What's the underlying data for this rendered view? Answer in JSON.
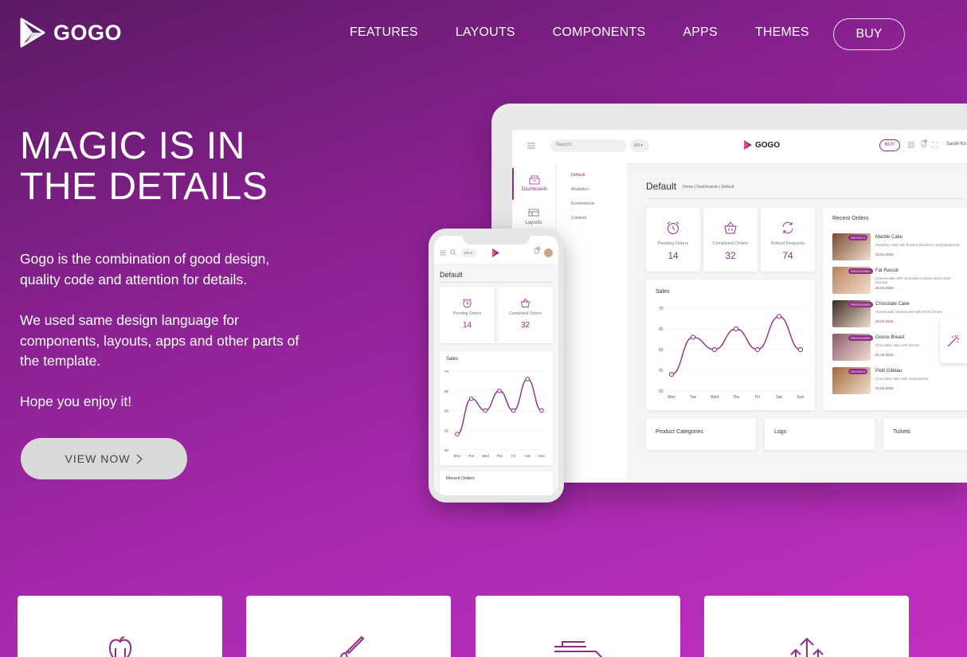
{
  "nav": {
    "logo": "GOGO",
    "links": [
      "FEATURES",
      "LAYOUTS",
      "COMPONENTS",
      "APPS",
      "THEMES"
    ],
    "buy": "BUY"
  },
  "hero": {
    "title_line1": "MAGIC IS IN",
    "title_line2": "THE DETAILS",
    "p1": "Gogo is the combination of good design, quality code and attention for details.",
    "p2": "We used same design language for components, layouts, apps and other parts of the template.",
    "p3": "Hope you enjoy it!",
    "button": "VIEW NOW"
  },
  "laptop": {
    "search": "Search",
    "lang": "EN ▾",
    "logo": "GOGO",
    "buy": "BUY",
    "user": "Sarah Ko",
    "side_dashboards": "Dashboards",
    "side_layouts": "Layouts",
    "submenu": [
      "Default",
      "Analytics",
      "Ecommerce",
      "Content"
    ],
    "page_title": "Default",
    "breadcrumb": "Home  |  Dashboards  |  Default",
    "stats": [
      {
        "label": "Pending Orders",
        "value": "14"
      },
      {
        "label": "Completed Orders",
        "value": "32"
      },
      {
        "label": "Refund Requests",
        "value": "74"
      }
    ],
    "sales_title": "Sales",
    "recent_orders_title": "Recent Orders",
    "orders": [
      {
        "name": "Marble Cake",
        "badge": "ON HOLD",
        "desc": "Wedding cake with flowers Macarons and blueberries",
        "date": "02.04.2018",
        "color": "#7a4a30"
      },
      {
        "name": "Fat Rascal",
        "badge": "PROCESSED",
        "desc": "Cheesecake with chocolate cookies and Cream biscuits",
        "date": "01.04.2018",
        "color": "#b9835a"
      },
      {
        "name": "Chocolate Cake",
        "badge": "PROCESSED",
        "desc": "Homemade cheesecake with fresh berries",
        "date": "25.03.2018",
        "color": "#3b2a22"
      },
      {
        "name": "Goose Breast",
        "badge": "PROCESSED",
        "desc": "Chocolate cake with berries",
        "date": "21.03.2018",
        "color": "#8a5a6a"
      },
      {
        "name": "Petit Gâteau",
        "badge": "ON HOLD",
        "desc": "Chocolate cake with mascarpone",
        "date": "01.03.2018",
        "color": "#a4683a"
      }
    ],
    "bottom": [
      "Product Categories",
      "Logs",
      "Tickets"
    ]
  },
  "phone": {
    "lang": "EN ▾",
    "title": "Default",
    "stats": [
      {
        "label": "Pending Orders",
        "value": "14"
      },
      {
        "label": "Completed Orders",
        "value": "32"
      }
    ],
    "sales_title": "Sales",
    "recent_orders": "Recent Orders"
  },
  "chart_data": {
    "type": "line",
    "title": "Sales",
    "categories": [
      "Mon",
      "Tue",
      "Wed",
      "Thu",
      "Fri",
      "Sat",
      "Sun"
    ],
    "values": [
      54,
      63,
      60,
      65,
      60,
      68,
      60
    ],
    "ylim": [
      50,
      70
    ],
    "yticks": [
      50,
      55,
      60,
      65,
      70
    ],
    "color": "#922c88"
  },
  "colors": {
    "accent": "#922c88"
  }
}
